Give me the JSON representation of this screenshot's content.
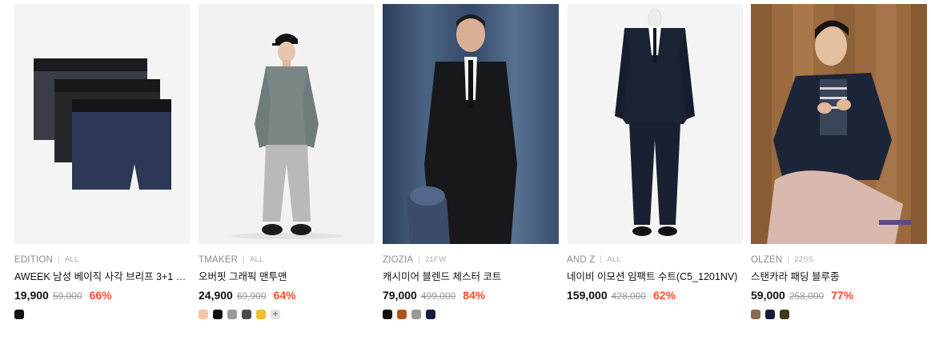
{
  "products": [
    {
      "brand": "EDITION",
      "season": "ALL",
      "title": "AWEEK 남성 베이직 사각 브리프 3+1 PA...",
      "price": "19,900",
      "original_price": "59,000",
      "discount": "66%",
      "image": "boxer-briefs-3pack",
      "swatches": [
        "#111111"
      ],
      "more_colors": ""
    },
    {
      "brand": "TMAKER",
      "season": "ALL",
      "title": "오버핏 그래픽 맨투맨",
      "price": "24,900",
      "original_price": "69,900",
      "discount": "64%",
      "image": "grey-sweatshirt-model",
      "swatches": [
        "#f3c7a4",
        "#111111",
        "#9a9a9a",
        "#4a4a4a",
        "#f0c030"
      ],
      "more_colors": "+"
    },
    {
      "brand": "ZIOZIA",
      "season": "21FW",
      "title": "캐시미어 블렌드 체스터 코트",
      "price": "79,000",
      "original_price": "499,000",
      "discount": "84%",
      "image": "chester-coat-model",
      "swatches": [
        "#111111",
        "#b5531c",
        "#9a9a9a",
        "#151b3d"
      ],
      "more_colors": ""
    },
    {
      "brand": "AND Z",
      "season": "ALL",
      "title": "네이비 이모션 임팩트 수트(C5_1201NV)",
      "price": "159,000",
      "original_price": "428,000",
      "discount": "62%",
      "image": "navy-suit-mannequin",
      "swatches": [],
      "more_colors": ""
    },
    {
      "brand": "OLZEN",
      "season": "22SS",
      "title": "스탠카라 패딩 블루종",
      "price": "59,000",
      "original_price": "258,000",
      "discount": "77%",
      "image": "padded-blouson-model",
      "swatches": [
        "#8b6a52",
        "#151b3d",
        "#3d3a1c"
      ],
      "more_colors": ""
    }
  ]
}
